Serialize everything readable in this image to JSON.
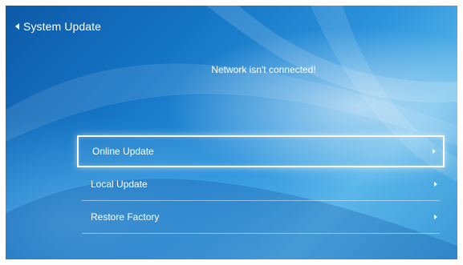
{
  "header": {
    "title": "System Update",
    "back_icon": "caret-left-icon"
  },
  "status": {
    "message": "Network isn't connected!"
  },
  "menu": {
    "items": [
      {
        "label": "Online Update",
        "icon": "chevron-right-icon",
        "selected": true
      },
      {
        "label": "Local Update",
        "icon": "chevron-right-icon",
        "selected": false
      },
      {
        "label": "Restore Factory",
        "icon": "chevron-right-icon",
        "selected": false
      }
    ]
  },
  "colors": {
    "background_dark": "#0d5aa8",
    "background_light": "#5ab6ea",
    "text": "#ffffff"
  }
}
